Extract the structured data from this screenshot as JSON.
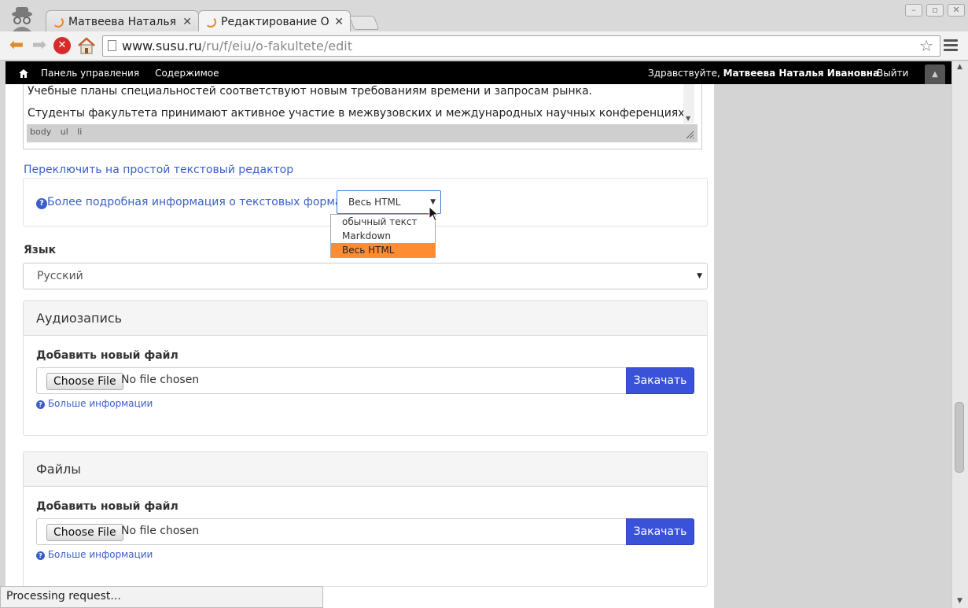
{
  "tabs": [
    {
      "title": "Матвеева Наталья И",
      "faded": "в"
    },
    {
      "title": "Редактирование О",
      "faded": "с"
    }
  ],
  "address": {
    "host": "www.susu.ru",
    "path": "/ru/f/eiu/o-fakultete/edit"
  },
  "adminbar": {
    "control_panel": "Панель управления",
    "content": "Содержимое",
    "greeting": "Здравствуйте, ",
    "user": "Матвеева Наталья Ивановна",
    "user_suffix": ".",
    "logout": "Выйти"
  },
  "editor": {
    "lines": [
      "Учебные планы специальностей соответствуют новым требованиям времени и запросам рынка.",
      "Студенты факультета принимают активное участие в межвузовских и международных научных конференциях и"
    ],
    "path": [
      "body",
      "ul",
      "li"
    ]
  },
  "switch_link": "Переключить на простой текстовый редактор",
  "format": {
    "help": "Более подробная информация о текстовых форматах",
    "selected": "Весь HTML",
    "options": [
      "обычный текст",
      "Markdown",
      "Весь HTML"
    ]
  },
  "language": {
    "label": "Язык",
    "selected": "Русский"
  },
  "panels": [
    {
      "title": "Аудиозапись",
      "add_label": "Добавить новый файл",
      "choose": "Choose File",
      "no_file": "No file chosen",
      "upload": "Закачать",
      "more": "Больше информации"
    },
    {
      "title": "Файлы",
      "add_label": "Добавить новый файл",
      "choose": "Choose File",
      "no_file": "No file chosen",
      "upload": "Закачать",
      "more": "Больше информации"
    }
  ],
  "status": "Processing request...",
  "icons": {
    "help": "?",
    "caret": "▼"
  }
}
